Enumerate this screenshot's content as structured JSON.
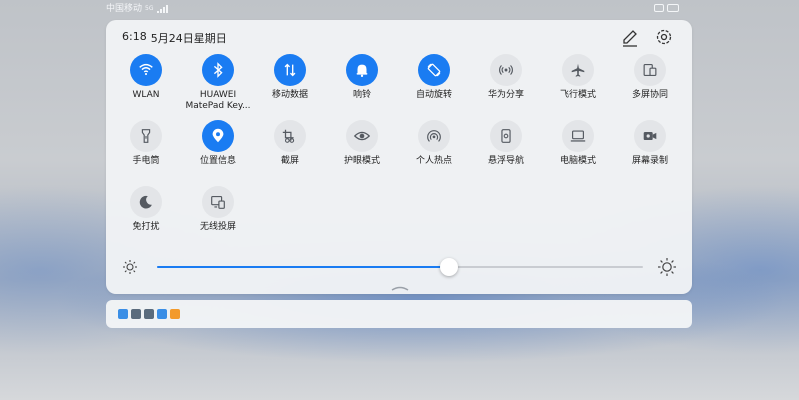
{
  "status_bar": {
    "carrier": "中国移动",
    "network": "5G",
    "signal_level": 4
  },
  "header": {
    "time": "6:18",
    "date": "5月24日星期日"
  },
  "tiles": [
    {
      "name": "tile-wlan",
      "icon": "wifi-icon",
      "label": "WLAN",
      "on": true
    },
    {
      "name": "tile-bluetooth",
      "icon": "bluetooth-icon",
      "label": "HUAWEI\nMatePad Key...",
      "on": true
    },
    {
      "name": "tile-mobile-data",
      "icon": "mobile-data-icon",
      "label": "移动数据",
      "on": true
    },
    {
      "name": "tile-ring",
      "icon": "bell-icon",
      "label": "响铃",
      "on": true
    },
    {
      "name": "tile-auto-rotate",
      "icon": "auto-rotate-icon",
      "label": "自动旋转",
      "on": true
    },
    {
      "name": "tile-huawei-share",
      "icon": "huawei-share-icon",
      "label": "华为分享",
      "on": false
    },
    {
      "name": "tile-airplane",
      "icon": "airplane-icon",
      "label": "飞行模式",
      "on": false
    },
    {
      "name": "tile-multiscreen",
      "icon": "multiscreen-icon",
      "label": "多屏协同",
      "on": false
    },
    {
      "name": "tile-flashlight",
      "icon": "flashlight-icon",
      "label": "手电筒",
      "on": false
    },
    {
      "name": "tile-location",
      "icon": "location-icon",
      "label": "位置信息",
      "on": true
    },
    {
      "name": "tile-screenshot",
      "icon": "screenshot-icon",
      "label": "截屏",
      "on": false
    },
    {
      "name": "tile-eye-comfort",
      "icon": "eye-icon",
      "label": "护眼模式",
      "on": false
    },
    {
      "name": "tile-hotspot",
      "icon": "hotspot-icon",
      "label": "个人热点",
      "on": false
    },
    {
      "name": "tile-floating-nav",
      "icon": "floating-nav-icon",
      "label": "悬浮导航",
      "on": false
    },
    {
      "name": "tile-pc-mode",
      "icon": "laptop-icon",
      "label": "电脑模式",
      "on": false
    },
    {
      "name": "tile-screen-record",
      "icon": "video-record-icon",
      "label": "屏幕录制",
      "on": false
    },
    {
      "name": "tile-do-not-disturb",
      "icon": "moon-icon",
      "label": "免打扰",
      "on": false
    },
    {
      "name": "tile-wireless-projection",
      "icon": "wireless-projection-icon",
      "label": "无线投屏",
      "on": false
    }
  ],
  "brightness": {
    "level": 0.6
  },
  "notification_icons": [
    {
      "name": "app-icon-1",
      "color": "#3a8ee6"
    },
    {
      "name": "app-icon-2",
      "color": "#5a6b7d"
    },
    {
      "name": "app-icon-3",
      "color": "#5a6b7d"
    },
    {
      "name": "app-icon-4",
      "color": "#3a8ee6"
    },
    {
      "name": "app-icon-5",
      "color": "#f39a2b"
    }
  ],
  "colors": {
    "accent": "#1a7cf2",
    "tile_off": "#e3e5e8",
    "icon_off": "#555a61"
  }
}
